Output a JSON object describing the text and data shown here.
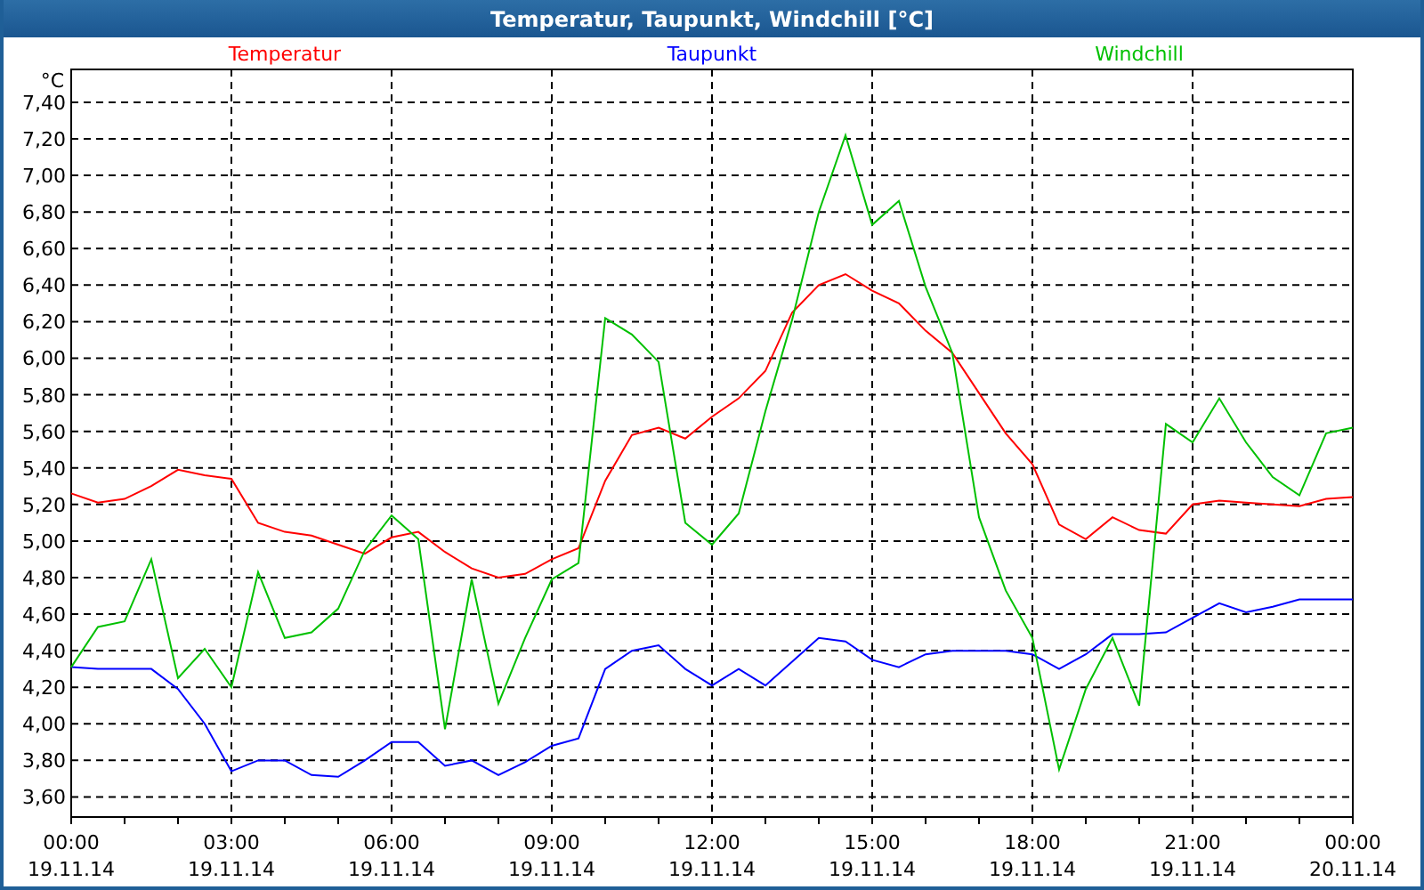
{
  "window": {
    "title": "Temperatur, Taupunkt, Windchill [°C]"
  },
  "chart_data": {
    "type": "line",
    "ylabel": "°C",
    "categories": [
      "00:00\n19.11.14",
      null,
      null,
      null,
      null,
      null,
      "03:00\n19.11.14",
      null,
      null,
      null,
      null,
      null,
      "06:00\n19.11.14",
      null,
      null,
      null,
      null,
      null,
      "09:00\n19.11.14",
      null,
      null,
      null,
      null,
      null,
      "12:00\n19.11.14",
      null,
      null,
      null,
      null,
      null,
      "15:00\n19.11.14",
      null,
      null,
      null,
      null,
      null,
      "18:00\n19.11.14",
      null,
      null,
      null,
      null,
      null,
      "21:00\n19.11.14",
      null,
      null,
      null,
      null,
      null,
      "00:00\n20.11.14"
    ],
    "ylim": [
      3.49,
      7.58
    ],
    "grid": true,
    "yticks": [
      {
        "value": 3.6,
        "label": "3,60"
      },
      {
        "value": 3.8,
        "label": "3,80"
      },
      {
        "value": 4.0,
        "label": "4,00"
      },
      {
        "value": 4.2,
        "label": "4,20"
      },
      {
        "value": 4.4,
        "label": "4,40"
      },
      {
        "value": 4.6,
        "label": "4,60"
      },
      {
        "value": 4.8,
        "label": "4,80"
      },
      {
        "value": 5.0,
        "label": "5,00"
      },
      {
        "value": 5.2,
        "label": "5,20"
      },
      {
        "value": 5.4,
        "label": "5,40"
      },
      {
        "value": 5.6,
        "label": "5,60"
      },
      {
        "value": 5.8,
        "label": "5,80"
      },
      {
        "value": 6.0,
        "label": "6,00"
      },
      {
        "value": 6.2,
        "label": "6,20"
      },
      {
        "value": 6.4,
        "label": "6,40"
      },
      {
        "value": 6.6,
        "label": "6,60"
      },
      {
        "value": 6.8,
        "label": "6,80"
      },
      {
        "value": 7.0,
        "label": "7,00"
      },
      {
        "value": 7.2,
        "label": "7,20"
      },
      {
        "value": 7.4,
        "label": "7,40"
      }
    ],
    "series": [
      {
        "name": "Temperatur",
        "color": "#ff0000",
        "values": [
          5.26,
          5.21,
          5.23,
          5.3,
          5.39,
          5.36,
          5.34,
          5.1,
          5.05,
          5.03,
          4.98,
          4.93,
          5.02,
          5.05,
          4.94,
          4.85,
          4.8,
          4.82,
          4.9,
          4.96,
          5.33,
          5.58,
          5.62,
          5.56,
          5.68,
          5.78,
          5.93,
          6.25,
          6.4,
          6.46,
          6.37,
          6.3,
          6.15,
          6.03,
          5.81,
          5.59,
          5.42,
          5.09,
          5.01,
          5.13,
          5.06,
          5.04,
          5.2,
          5.22,
          5.21,
          5.2,
          5.19,
          5.23,
          5.24
        ]
      },
      {
        "name": "Taupunkt",
        "color": "#0000ff",
        "values": [
          4.31,
          4.3,
          4.3,
          4.3,
          4.19,
          4.0,
          3.74,
          3.8,
          3.8,
          3.72,
          3.71,
          3.8,
          3.9,
          3.9,
          3.77,
          3.8,
          3.72,
          3.79,
          3.88,
          3.92,
          4.3,
          4.4,
          4.43,
          4.3,
          4.21,
          4.3,
          4.21,
          4.34,
          4.47,
          4.45,
          4.35,
          4.31,
          4.38,
          4.4,
          4.4,
          4.4,
          4.38,
          4.3,
          4.38,
          4.49,
          4.49,
          4.5,
          4.58,
          4.66,
          4.61,
          4.64,
          4.68,
          4.68,
          4.68
        ]
      },
      {
        "name": "Windchill",
        "color": "#00c000",
        "values": [
          4.31,
          4.53,
          4.56,
          4.9,
          4.25,
          4.41,
          4.2,
          4.83,
          4.47,
          4.5,
          4.63,
          4.95,
          5.14,
          5.01,
          3.97,
          4.79,
          4.11,
          4.47,
          4.79,
          4.88,
          6.22,
          6.13,
          5.98,
          5.1,
          4.98,
          5.15,
          5.71,
          6.21,
          6.8,
          7.22,
          6.73,
          6.86,
          6.39,
          6.03,
          5.13,
          4.73,
          4.47,
          3.75,
          4.19,
          4.47,
          4.1,
          5.64,
          5.54,
          5.78,
          5.54,
          5.35,
          5.25,
          5.59,
          5.62
        ]
      }
    ]
  }
}
